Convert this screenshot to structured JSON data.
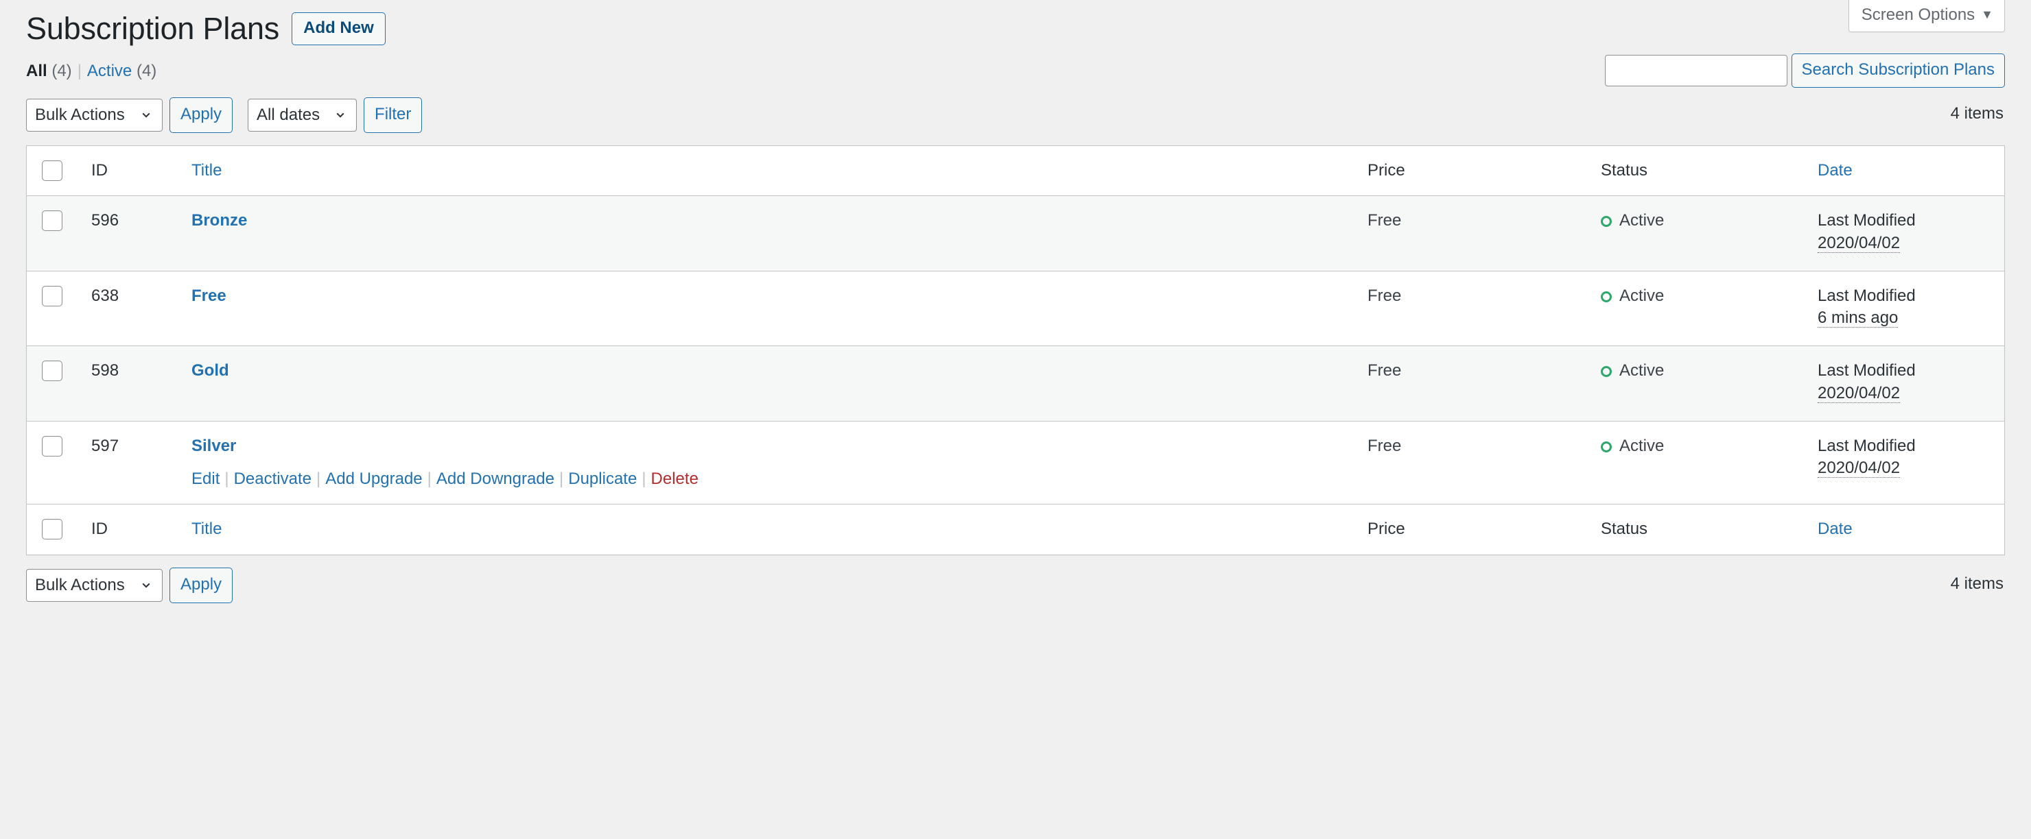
{
  "screen_meta": {
    "screen_options_label": "Screen Options",
    "caret": "▼"
  },
  "header": {
    "title": "Subscription Plans",
    "add_new_label": "Add New"
  },
  "views": {
    "all": {
      "label": "All",
      "count": "(4)"
    },
    "separator": "|",
    "active": {
      "label": "Active",
      "count": "(4)"
    }
  },
  "search": {
    "value": "",
    "placeholder": "",
    "submit_label": "Search Subscription Plans"
  },
  "tablenav_top": {
    "bulk_actions_label": "Bulk Actions",
    "apply_label": "Apply",
    "dates_label": "All dates",
    "filter_label": "Filter",
    "displaying_num": "4 items"
  },
  "tablenav_bottom": {
    "bulk_actions_label": "Bulk Actions",
    "apply_label": "Apply",
    "displaying_num": "4 items"
  },
  "table": {
    "columns": {
      "id": "ID",
      "title": "Title",
      "price": "Price",
      "status": "Status",
      "date": "Date"
    },
    "rows": [
      {
        "id": "596",
        "title": "Bronze",
        "price": "Free",
        "status": "Active",
        "date_label": "Last Modified",
        "date_value": "2020/04/02"
      },
      {
        "id": "638",
        "title": "Free",
        "price": "Free",
        "status": "Active",
        "date_label": "Last Modified",
        "date_value": "6 mins ago"
      },
      {
        "id": "598",
        "title": "Gold",
        "price": "Free",
        "status": "Active",
        "date_label": "Last Modified",
        "date_value": "2020/04/02"
      },
      {
        "id": "597",
        "title": "Silver",
        "price": "Free",
        "status": "Active",
        "date_label": "Last Modified",
        "date_value": "2020/04/02"
      }
    ],
    "row_actions": {
      "edit": "Edit",
      "deactivate": "Deactivate",
      "add_upgrade": "Add Upgrade",
      "add_downgrade": "Add Downgrade",
      "duplicate": "Duplicate",
      "delete": "Delete",
      "separator": "|"
    }
  },
  "colors": {
    "link": "#2271b1",
    "link_dark": "#0a4b78",
    "delete": "#b32d2e",
    "status_active": "#2ea86a",
    "page_bg": "#f0f0f1",
    "row_alt_bg": "#f6f7f7",
    "border": "#c3c4c7"
  }
}
